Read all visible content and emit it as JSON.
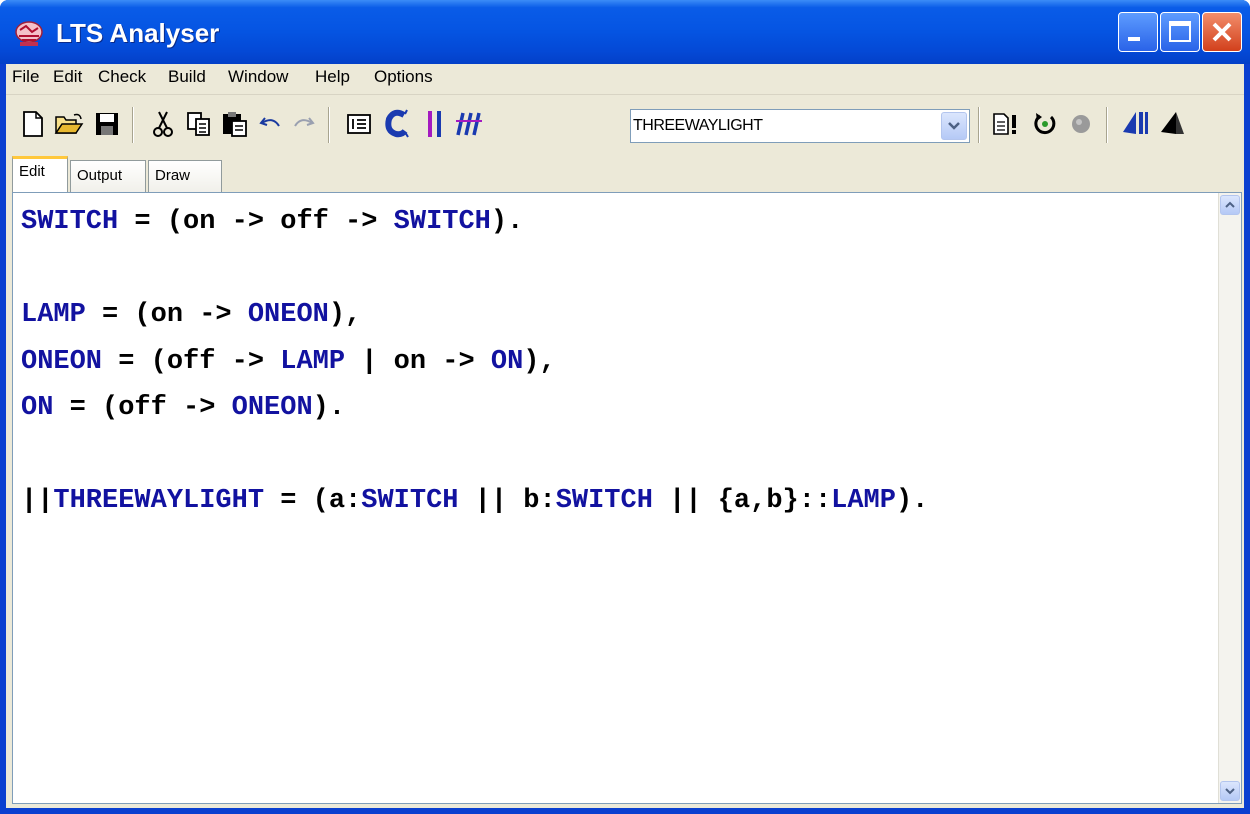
{
  "window": {
    "title": "LTS Analyser"
  },
  "menu": [
    "File",
    "Edit",
    "Check",
    "Build",
    "Window",
    "Help",
    "Options"
  ],
  "toolbar": {
    "target_value": "THREEWAYLIGHT"
  },
  "tabs": [
    "Edit",
    "Output",
    "Draw"
  ],
  "editor": {
    "lines": [
      [
        [
          "SWITCH",
          "kw"
        ],
        [
          " = (on -> off -> ",
          ""
        ],
        [
          "SWITCH",
          "kw"
        ],
        [
          ").",
          ""
        ]
      ],
      [],
      [
        [
          "LAMP",
          "kw"
        ],
        [
          " = (on -> ",
          ""
        ],
        [
          "ONEON",
          "kw"
        ],
        [
          "),",
          ""
        ]
      ],
      [
        [
          "ONEON",
          "kw"
        ],
        [
          " = (off -> ",
          ""
        ],
        [
          "LAMP",
          "kw"
        ],
        [
          " | on -> ",
          ""
        ],
        [
          "ON",
          "kw"
        ],
        [
          "),",
          ""
        ]
      ],
      [
        [
          "ON",
          "kw"
        ],
        [
          " = (off -> ",
          ""
        ],
        [
          "ONEON",
          "kw"
        ],
        [
          ").",
          ""
        ]
      ],
      [],
      [
        [
          "||",
          ""
        ],
        [
          "THREEWAYLIGHT",
          "kw"
        ],
        [
          " = (a:",
          ""
        ],
        [
          "SWITCH",
          "kw"
        ],
        [
          " || b:",
          ""
        ],
        [
          "SWITCH",
          "kw"
        ],
        [
          " || {a,b}::",
          ""
        ],
        [
          "LAMP",
          "kw"
        ],
        [
          ").",
          ""
        ]
      ]
    ]
  },
  "colors": {
    "keyword": "#1212a0",
    "titlebar": "#0554e2",
    "tab_highlight": "#ffc83c"
  }
}
